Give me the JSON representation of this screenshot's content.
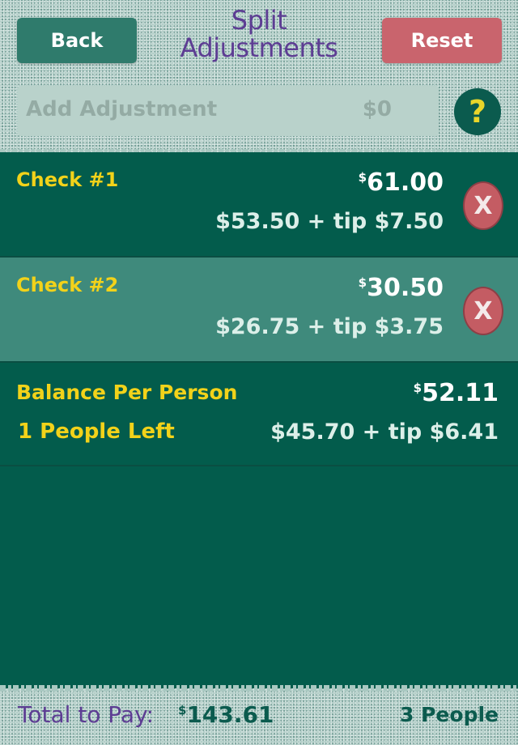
{
  "header": {
    "back_label": "Back",
    "reset_label": "Reset",
    "title_line1": "Split",
    "title_line2": "Adjustments"
  },
  "add_adjustment": {
    "placeholder": "Add Adjustment",
    "value": "$0",
    "help_label": "?"
  },
  "checks": [
    {
      "name": "Check #1",
      "total": "61.00",
      "breakdown": "$53.50 + tip $7.50",
      "delete_label": "X"
    },
    {
      "name": "Check #2",
      "total": "30.50",
      "breakdown": "$26.75 + tip $3.75",
      "delete_label": "X"
    }
  ],
  "balance": {
    "label": "Balance Per Person",
    "people_left": "1 People Left",
    "total": "52.11",
    "breakdown": "$45.70 + tip $6.41"
  },
  "footer": {
    "total_label": "Total to Pay:",
    "total_value": "143.61",
    "people": "3 People"
  },
  "colors": {
    "background": "#035c4c",
    "check_selected": "#3f8a7c",
    "title": "#5d3d93",
    "label_yellow": "#f2d21a",
    "back_button": "#2f7b6c",
    "reset_button": "#c9646d"
  }
}
